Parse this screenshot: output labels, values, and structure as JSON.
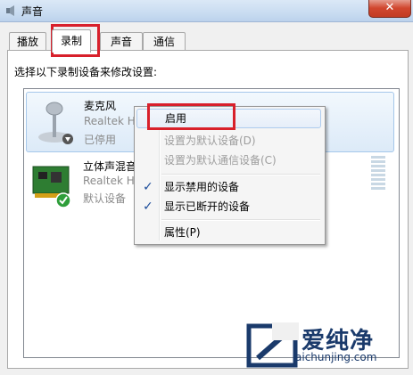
{
  "window": {
    "title": "声音",
    "close_label": "✕"
  },
  "tabs": [
    {
      "label": "播放"
    },
    {
      "label": "录制"
    },
    {
      "label": "声音"
    },
    {
      "label": "通信"
    }
  ],
  "instruction": "选择以下录制设备来修改设置:",
  "devices": [
    {
      "name": "麦克风",
      "driver": "Realtek H",
      "status": "已停用",
      "icon": "microphone-icon"
    },
    {
      "name": "立体声混音",
      "driver": "Realtek H",
      "status": "默认设备",
      "icon": "sound-card-icon"
    }
  ],
  "context_menu": {
    "items": [
      {
        "label": "启用",
        "enabled": true,
        "checked": false
      },
      {
        "label": "设置为默认设备(D)",
        "enabled": false,
        "checked": false
      },
      {
        "label": "设置为默认通信设备(C)",
        "enabled": false,
        "checked": false
      },
      {
        "label": "显示禁用的设备",
        "enabled": true,
        "checked": true
      },
      {
        "label": "显示已断开的设备",
        "enabled": true,
        "checked": true
      },
      {
        "label": "属性(P)",
        "enabled": true,
        "checked": false
      }
    ]
  },
  "watermark": {
    "brand": "爱纯净",
    "url": "aichunjing.com"
  },
  "colors": {
    "highlight": "#d8202b",
    "selection": "#dceaf8",
    "watermark": "#1a3a6b"
  }
}
